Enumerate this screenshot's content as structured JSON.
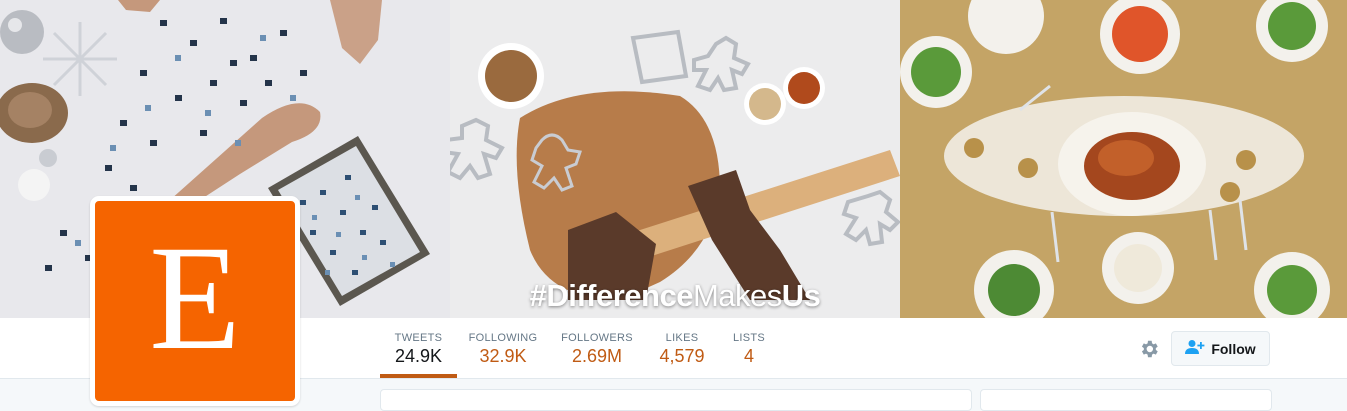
{
  "banner": {
    "hashtag_bold_1": "#Difference",
    "hashtag_light": "Makes",
    "hashtag_bold_2": "Us"
  },
  "profile": {
    "avatar_letter": "E",
    "brand_color": "#f56400",
    "link_color": "#c05b14"
  },
  "stats": [
    {
      "label": "TWEETS",
      "value": "24.9K"
    },
    {
      "label": "FOLLOWING",
      "value": "32.9K"
    },
    {
      "label": "FOLLOWERS",
      "value": "2.69M"
    },
    {
      "label": "LIKES",
      "value": "4,579"
    },
    {
      "label": "LISTS",
      "value": "4"
    }
  ],
  "actions": {
    "settings_icon": "gear-icon",
    "follow_icon": "person-plus-icon",
    "follow_label": "Follow"
  }
}
